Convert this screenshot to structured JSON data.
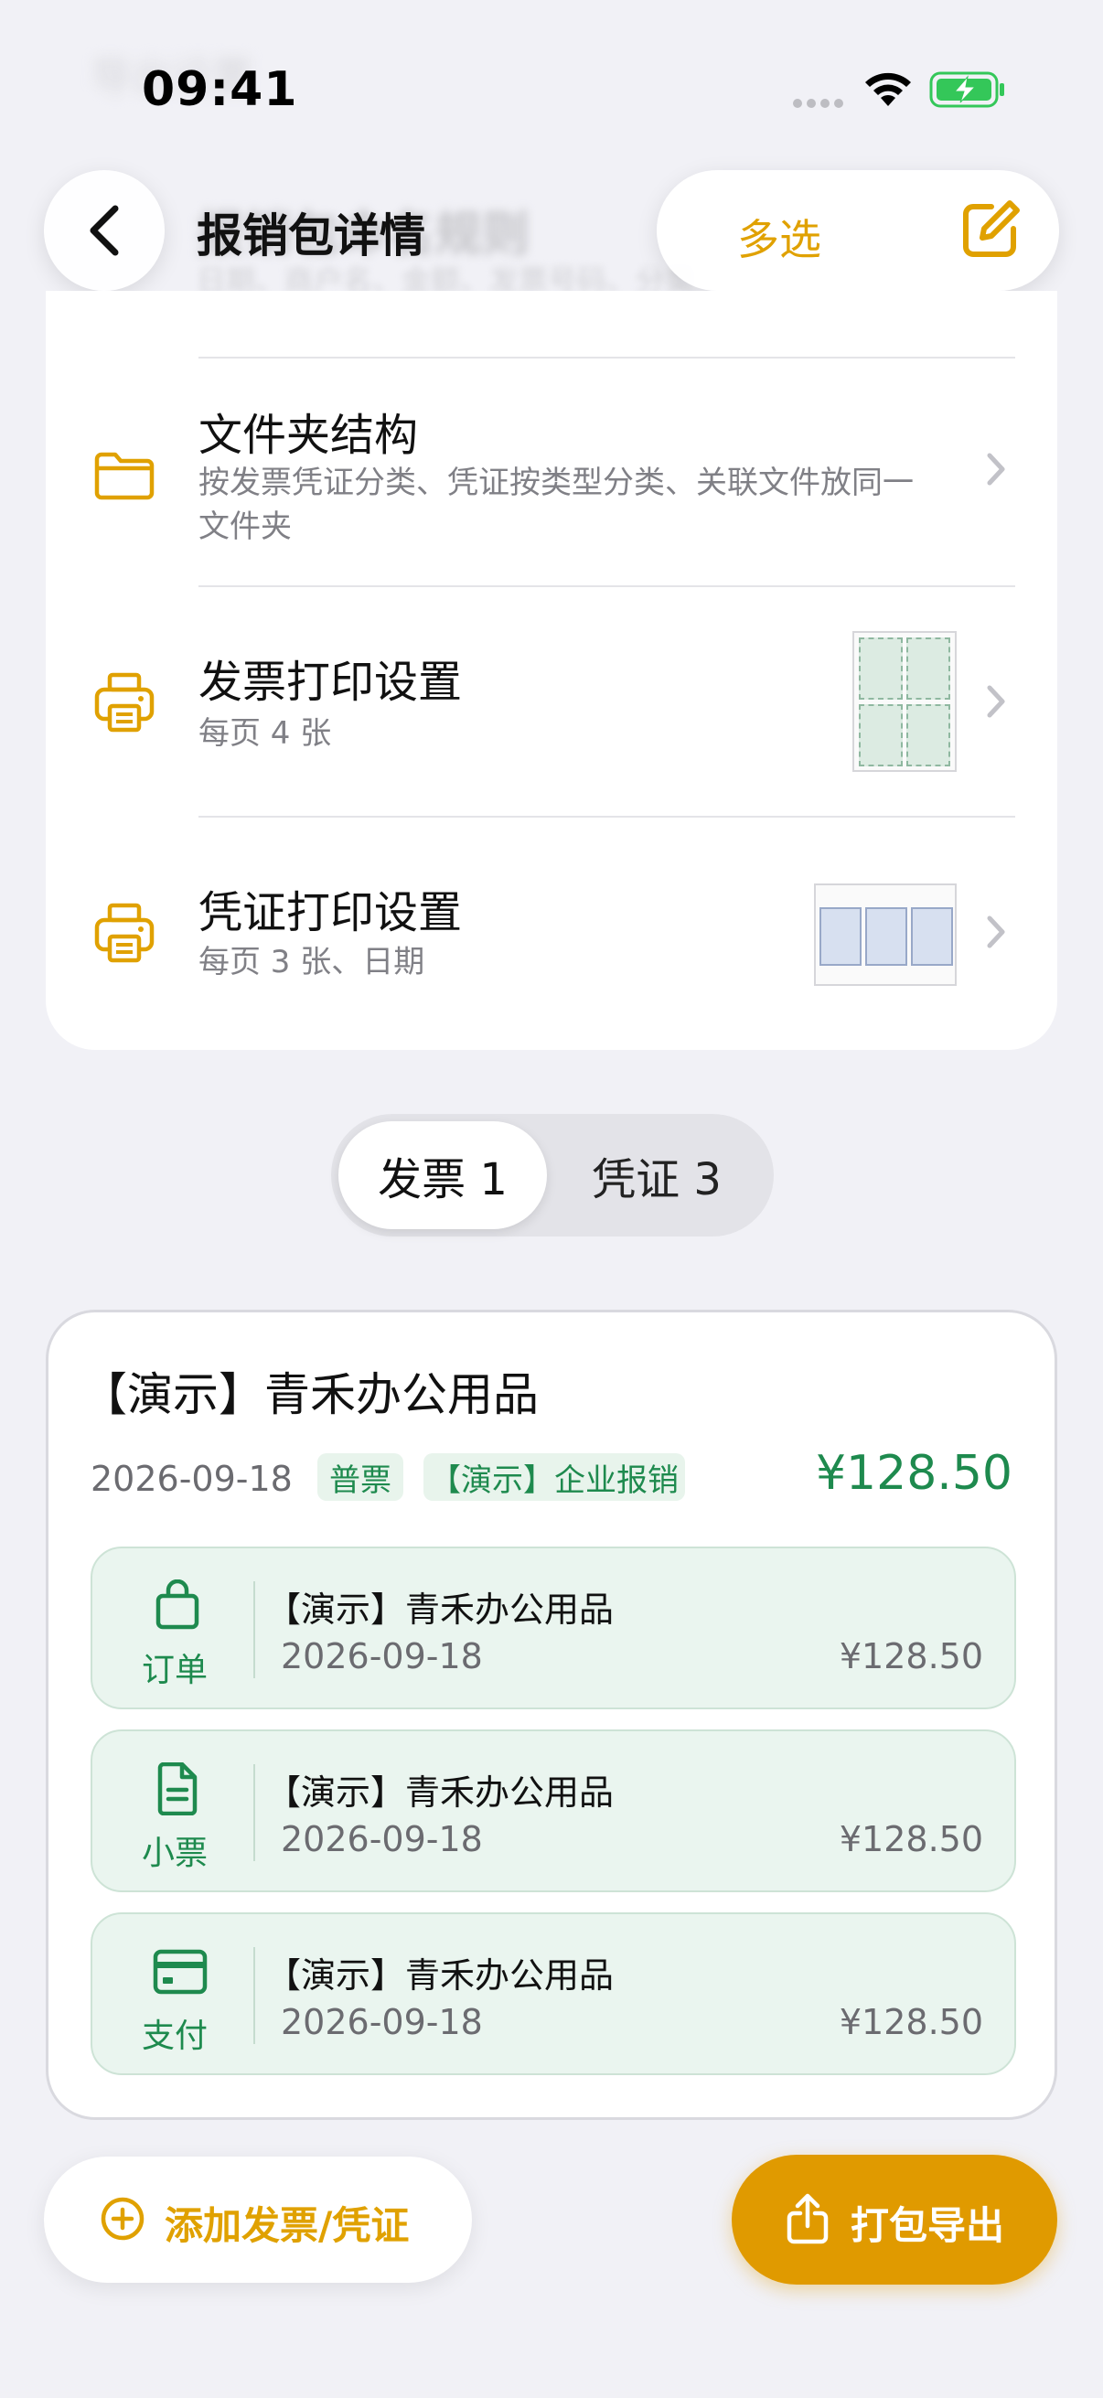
{
  "status_bar": {
    "time": "09:41"
  },
  "background_blur": {
    "top_text": "导出设置",
    "title": "报销包命名规则",
    "subtitle": "日期、商户名、金额、发票号码、分类"
  },
  "nav": {
    "title": "报销包详情",
    "multi_select_label": "多选"
  },
  "settings": {
    "folder": {
      "title": "文件夹结构",
      "subtitle": "按发票凭证分类、凭证按类型分类、关联文件放同一文件夹"
    },
    "invoice_print": {
      "title": "发票打印设置",
      "subtitle": "每页 4 张"
    },
    "voucher_print": {
      "title": "凭证打印设置",
      "subtitle": "每页 3 张、日期"
    }
  },
  "tabs": [
    {
      "label": "发票 1",
      "active": true
    },
    {
      "label": "凭证 3",
      "active": false
    }
  ],
  "invoice": {
    "title": "【演示】青禾办公用品",
    "date": "2026-09-18",
    "tags": [
      "普票",
      "【演示】企业报销"
    ],
    "amount": "¥128.50",
    "attachments": [
      {
        "type": "订单",
        "icon": "shopping-bag-icon",
        "name": "【演示】青禾办公用品",
        "date": "2026-09-18",
        "amount": "¥128.50"
      },
      {
        "type": "小票",
        "icon": "receipt-document-icon",
        "name": "【演示】青禾办公用品",
        "date": "2026-09-18",
        "amount": "¥128.50"
      },
      {
        "type": "支付",
        "icon": "credit-card-icon",
        "name": "【演示】青禾办公用品",
        "date": "2026-09-18",
        "amount": "¥128.50"
      }
    ]
  },
  "actions": {
    "add_label": "添加发票/凭证",
    "export_label": "打包导出"
  },
  "colors": {
    "accent": "#e0a100",
    "green": "#1e8a4e",
    "background": "#f1f1f6"
  }
}
